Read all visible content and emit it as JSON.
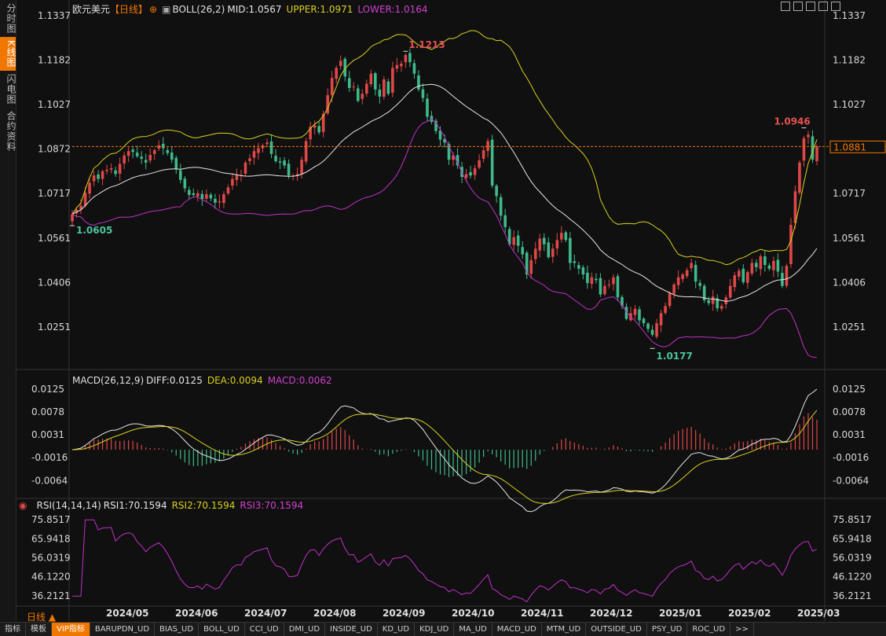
{
  "left_tabs": [
    "分时图",
    "K线图",
    "闪电图",
    "合约资料"
  ],
  "left_active": 1,
  "header": {
    "instrument": "欧元美元",
    "period_tag": "【日线】",
    "boll_label": "BOLL(26,2)",
    "mid": "MID:1.0567",
    "upper": "UPPER:1.0971",
    "lower": "LOWER:1.0164",
    "macd_label": "MACD(26,12,9)",
    "diff": "DIFF:0.0125",
    "dea": "DEA:0.0094",
    "macd": "MACD:0.0062",
    "rsi_label": "RSI(14,14,14)",
    "rsi1": "RSI1:70.1594",
    "rsi2": "RSI2:70.1594",
    "rsi3": "RSI3:70.1594"
  },
  "colors": {
    "up": "#e04848",
    "down": "#3fb98a",
    "upper": "#d8d020",
    "mid": "#e6e6e6",
    "lower": "#c030c8",
    "dea": "#d8d020",
    "diff": "#e6e6e6",
    "rsi": "#c030c8",
    "current": "#f07800"
  },
  "chart_data": [
    {
      "type": "candlestick",
      "title": "欧元美元",
      "indicator": "BOLL(26,2)",
      "y_ticks": [
        "1.1337",
        "1.1182",
        "1.1027",
        "1.0872",
        "1.0717",
        "1.0561",
        "1.0406",
        "1.0251"
      ],
      "ylim": [
        1.0131,
        1.1337
      ],
      "current_price": "1.0881",
      "current_value": 1.0881,
      "annotations": [
        {
          "text": "1.1213",
          "value": 1.1213,
          "type": "high"
        },
        {
          "text": "1.0605",
          "value": 1.0605,
          "type": "low"
        },
        {
          "text": "1.0946",
          "value": 1.0946,
          "type": "high"
        },
        {
          "text": "1.0177",
          "value": 1.0177,
          "type": "low"
        }
      ],
      "x_labels": [
        "2024/05",
        "2024/06",
        "2024/07",
        "2024/08",
        "2024/09",
        "2024/10",
        "2024/11",
        "2024/12",
        "2025/01",
        "2025/02",
        "2025/03"
      ],
      "close": [
        1.0645,
        1.066,
        1.0675,
        1.072,
        1.0755,
        1.078,
        1.0768,
        1.0795,
        1.08,
        1.0805,
        1.0785,
        1.082,
        1.085,
        1.0865,
        1.0862,
        1.0847,
        1.0838,
        1.0825,
        1.0852,
        1.0868,
        1.0885,
        1.0875,
        1.0858,
        1.0835,
        1.0802,
        1.0765,
        1.0735,
        1.0712,
        1.0712,
        1.0718,
        1.0698,
        1.0715,
        1.07,
        1.0685,
        1.069,
        1.0715,
        1.0738,
        1.0768,
        1.0782,
        1.0782,
        1.0825,
        1.084,
        1.0865,
        1.0875,
        1.0885,
        1.0895,
        1.0855,
        1.083,
        1.0825,
        1.0815,
        1.078,
        1.078,
        1.0785,
        1.0835,
        1.09,
        1.095,
        1.0955,
        1.093,
        1.0995,
        1.106,
        1.112,
        1.1155,
        1.118,
        1.1125,
        1.1085,
        1.109,
        1.104,
        1.1065,
        1.11,
        1.1135,
        1.108,
        1.1055,
        1.1115,
        1.1065,
        1.1155,
        1.1165,
        1.117,
        1.12,
        1.1175,
        1.1135,
        1.108,
        1.105,
        1.0985,
        1.0967,
        1.0935,
        1.0905,
        1.0895,
        1.0835,
        1.085,
        1.0815,
        1.0775,
        1.0785,
        1.078,
        1.0805,
        1.0833,
        1.0868,
        1.09,
        1.0745,
        1.0708,
        1.064,
        1.06,
        1.054,
        1.0565,
        1.0535,
        1.0505,
        1.0435,
        1.0485,
        1.0525,
        1.056,
        1.054,
        1.0495,
        1.0525,
        1.0555,
        1.058,
        1.0555,
        1.0475,
        1.0475,
        1.0455,
        1.0435,
        1.0405,
        1.0425,
        1.0415,
        1.0365,
        1.0395,
        1.04,
        1.0425,
        1.0355,
        1.0325,
        1.028,
        1.03,
        1.0315,
        1.0275,
        1.0265,
        1.0245,
        1.0225,
        1.0265,
        1.03,
        1.0325,
        1.037,
        1.04,
        1.0425,
        1.0435,
        1.045,
        1.0475,
        1.041,
        1.0395,
        1.0345,
        1.0335,
        1.0358,
        1.0317,
        1.0325,
        1.0355,
        1.0395,
        1.0432,
        1.0448,
        1.0408,
        1.0443,
        1.0475,
        1.046,
        1.0498,
        1.0468,
        1.0455,
        1.0482,
        1.0445,
        1.0395,
        1.0465,
        1.0608,
        1.0725,
        1.0825,
        1.091,
        1.0922,
        1.0835,
        1.0881
      ],
      "boll": {
        "mid": "1.0567",
        "upper": "1.0971",
        "lower": "1.0164"
      }
    },
    {
      "type": "macd",
      "title": "MACD(26,12,9)",
      "y_ticks": [
        "0.0125",
        "0.0078",
        "0.0031",
        "-0.0016",
        "-0.0064"
      ],
      "ylim": [
        -0.0094,
        0.0125
      ],
      "values": {
        "DIFF": 0.0125,
        "DEA": 0.0094,
        "MACD": 0.0062
      }
    },
    {
      "type": "line",
      "title": "RSI(14,14,14)",
      "y_ticks": [
        "75.8517",
        "65.9418",
        "56.0319",
        "46.1220",
        "36.2121"
      ],
      "ylim": [
        31.2,
        78.8
      ],
      "values": {
        "RSI1": 70.1594,
        "RSI2": 70.1594,
        "RSI3": 70.1594
      }
    }
  ],
  "bottom": {
    "period": "日线",
    "tabs": [
      "指标",
      "模板",
      "VIP指标",
      "BARUPDN_UD",
      "BIAS_UD",
      "BOLL_UD",
      "CCI_UD",
      "DMI_UD",
      "INSIDE_UD",
      "KD_UD",
      "KDJ_UD",
      "MA_UD",
      "MACD_UD",
      "MTM_UD",
      "OUTSIDE_UD",
      "PSY_UD",
      "ROC_UD",
      ">>"
    ],
    "active": 2
  }
}
